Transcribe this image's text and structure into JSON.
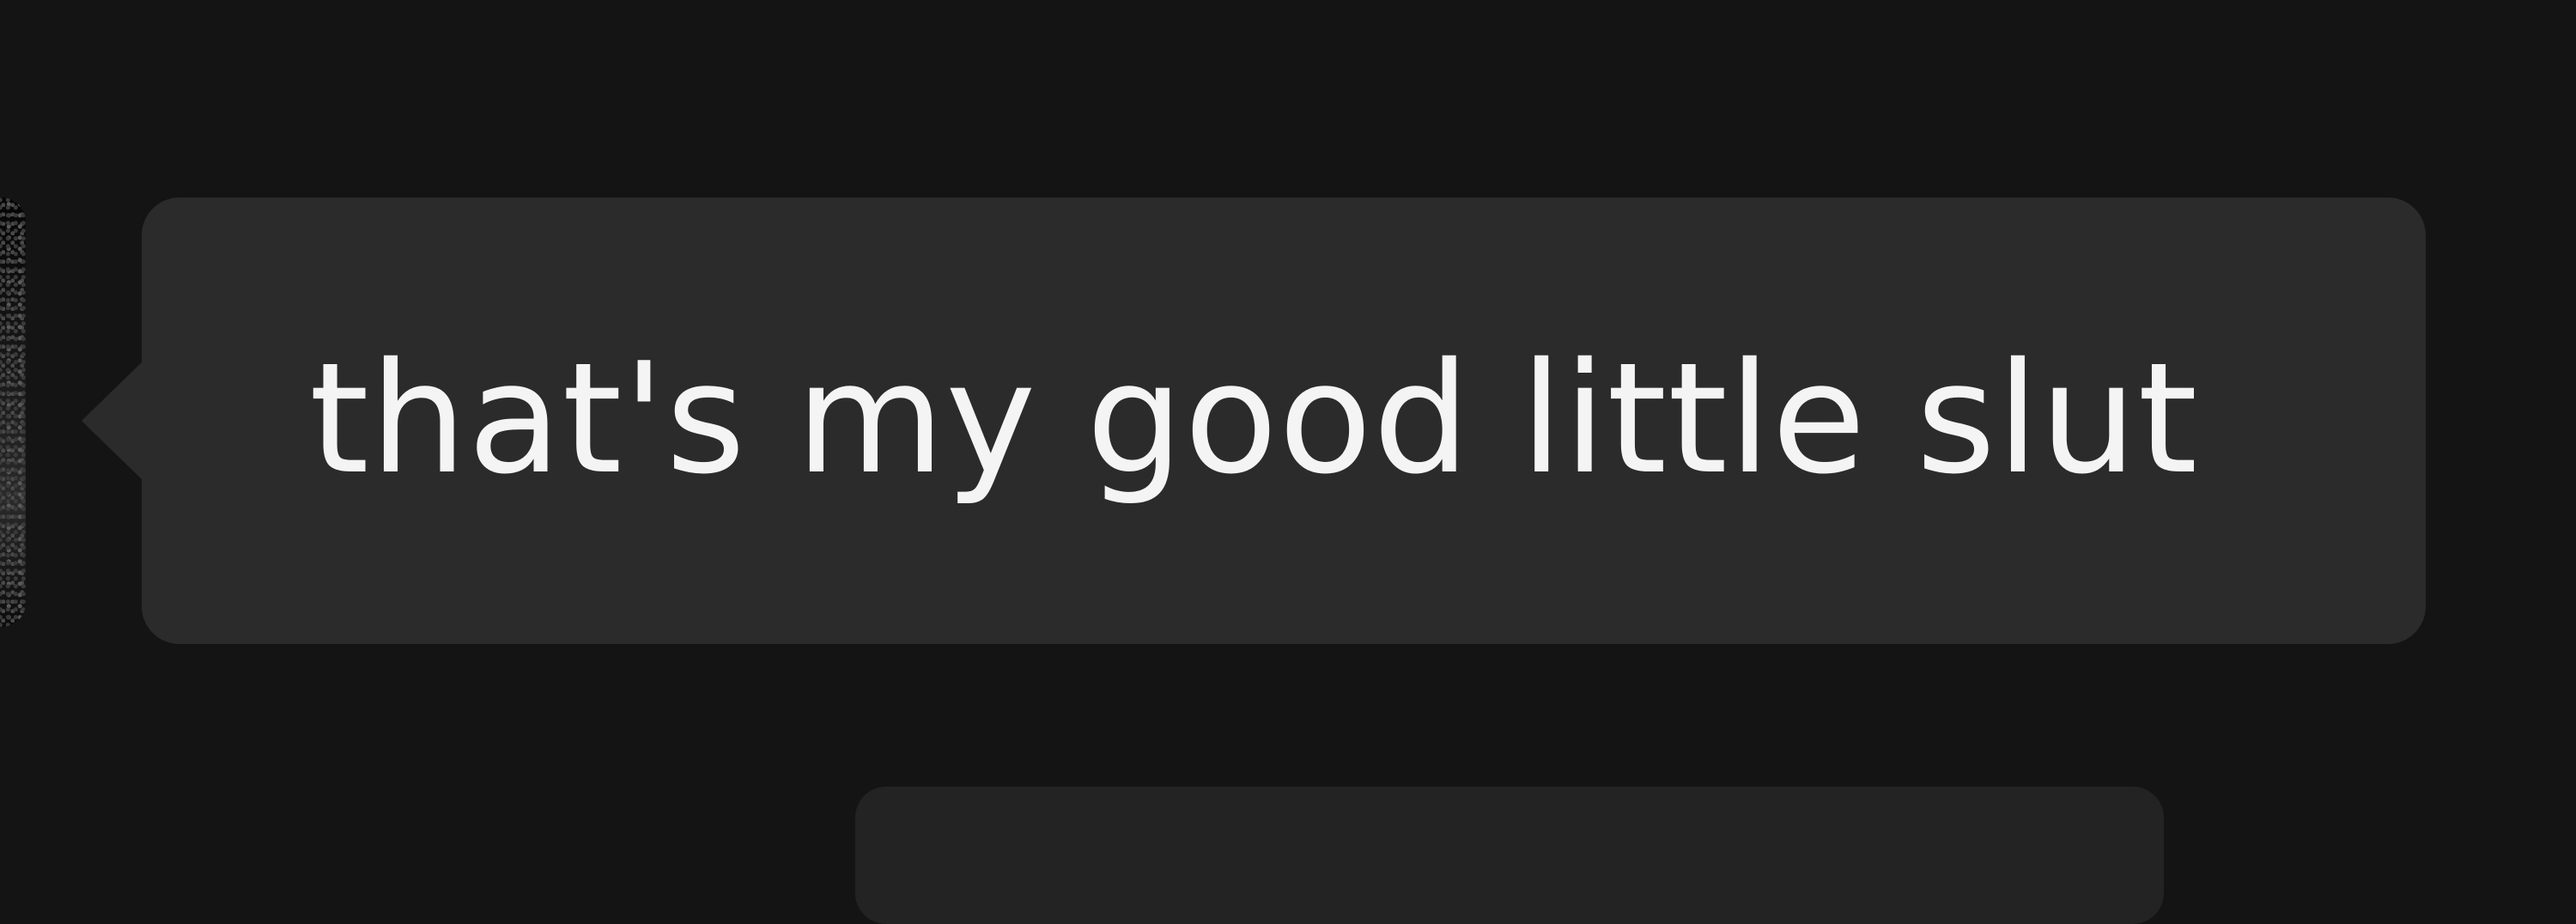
{
  "conversation": {
    "messages": [
      {
        "sender": "other",
        "text": "that's my good little slut"
      },
      {
        "sender": "next",
        "text": ""
      }
    ]
  },
  "theme": {
    "background": "#141414",
    "incoming_bubble": "#2b2b2b",
    "next_bubble": "#232323",
    "text_color": "#f4f4f4"
  }
}
